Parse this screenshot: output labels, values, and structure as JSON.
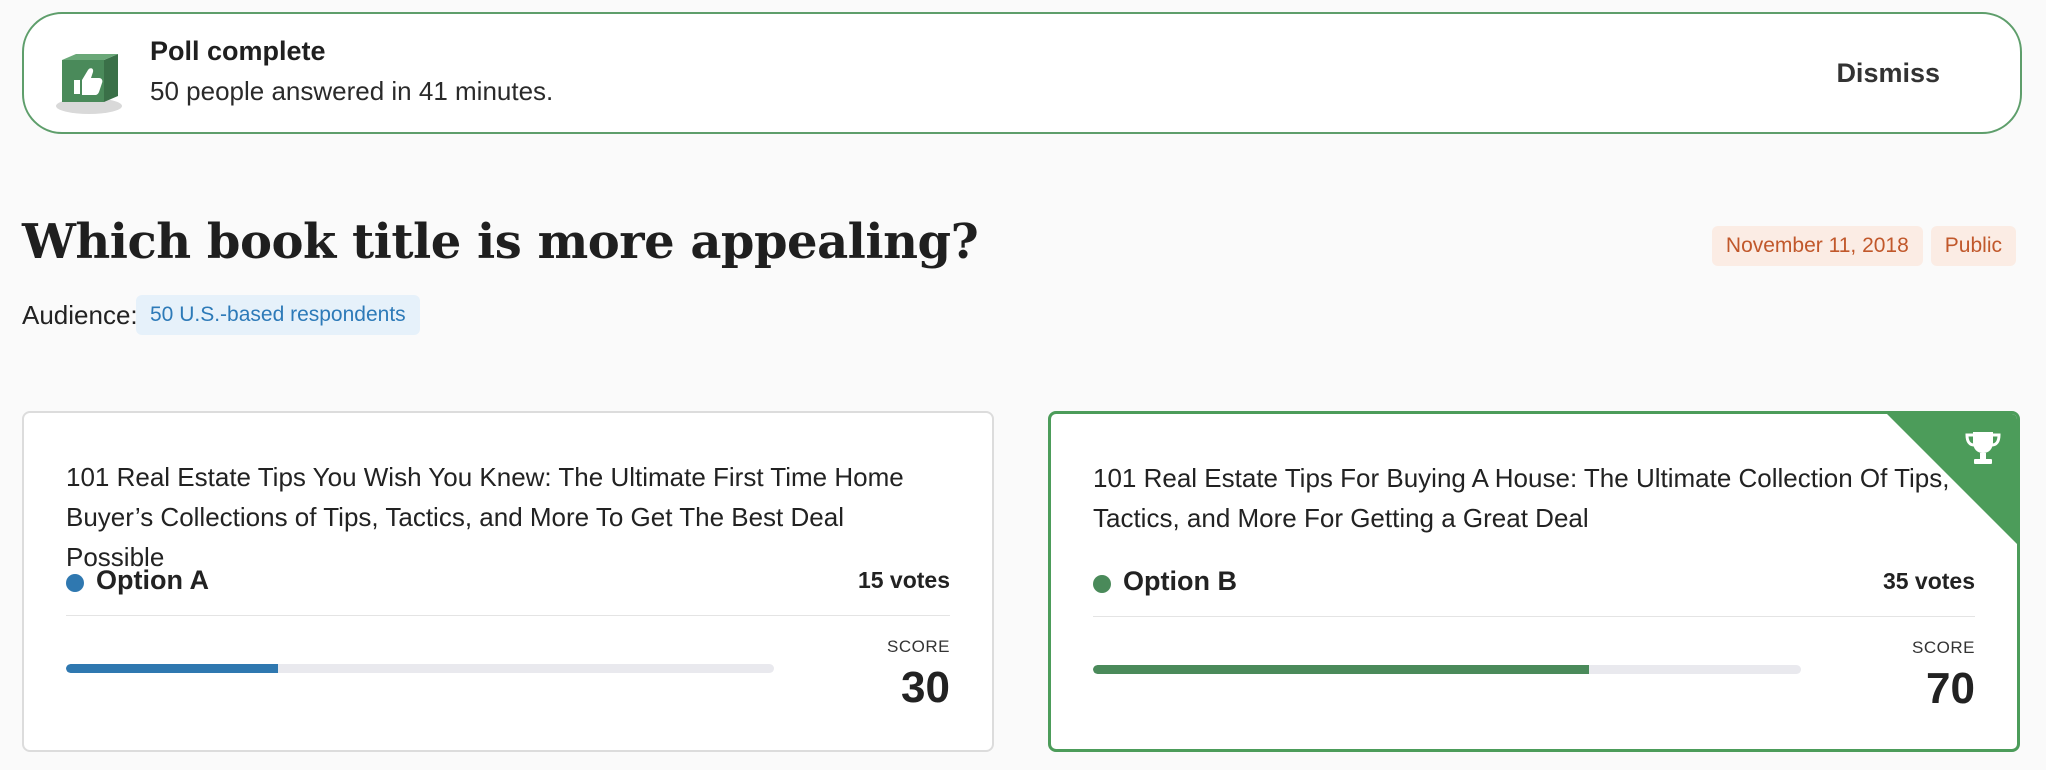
{
  "banner": {
    "icon": "thumbs-up-box-icon",
    "title": "Poll complete",
    "subtitle": "50 people answered in 41 minutes.",
    "dismiss_label": "Dismiss"
  },
  "poll": {
    "question": "Which book title is more appealing?",
    "date": "November 11, 2018",
    "visibility": "Public",
    "audience_label": "Audience:",
    "audience_value": "50 U.S.-based respondents"
  },
  "options": [
    {
      "text": "101 Real Estate Tips You Wish You Knew: The Ultimate First Time Home Buyer’s Collections of Tips, Tactics, and More To Get The Best Deal Possible",
      "label": "Option A",
      "votes": "15 votes",
      "score_label": "SCORE",
      "score": "30",
      "progress": 0.3,
      "color": "#2f78b0",
      "winner": false
    },
    {
      "text": "101 Real Estate Tips For Buying A House: The Ultimate Collection Of Tips, Tactics, and More For Getting a Great Deal",
      "label": "Option B",
      "votes": "35 votes",
      "score_label": "SCORE",
      "score": "70",
      "progress": 0.7,
      "color": "#4a8a5a",
      "winner": true,
      "winner_icon": "trophy-icon"
    }
  ],
  "colors": {
    "accent_green": "#4c9c5a",
    "tag_text": "#c1582b",
    "tag_bg": "#fbece4",
    "chip_text": "#2d7ab8",
    "chip_bg": "#e6f1fa"
  }
}
